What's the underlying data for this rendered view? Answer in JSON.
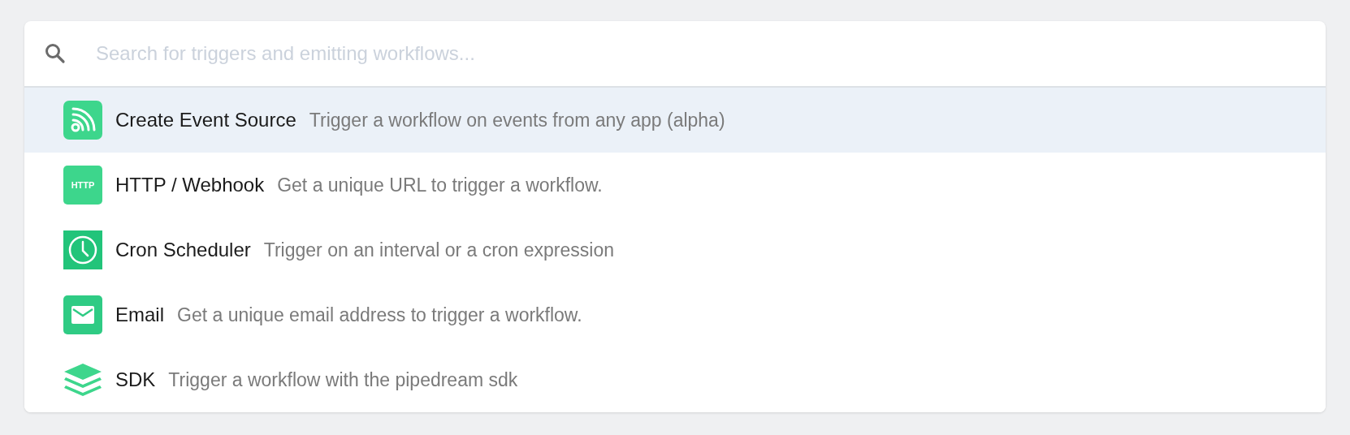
{
  "search": {
    "placeholder": "Search for triggers and emitting workflows..."
  },
  "items": [
    {
      "kind": "rss",
      "title": "Create Event Source",
      "description": "Trigger a workflow on events from any app (alpha)",
      "selected": true
    },
    {
      "kind": "http",
      "icon_text": "HTTP",
      "title": "HTTP / Webhook",
      "description": "Get a unique URL to trigger a workflow.",
      "selected": false
    },
    {
      "kind": "clock",
      "title": "Cron Scheduler",
      "description": "Trigger on an interval or a cron expression",
      "selected": false
    },
    {
      "kind": "email",
      "title": "Email",
      "description": "Get a unique email address to trigger a workflow.",
      "selected": false
    },
    {
      "kind": "layers",
      "title": "SDK",
      "description": "Trigger a workflow with the pipedream sdk",
      "selected": false
    }
  ]
}
